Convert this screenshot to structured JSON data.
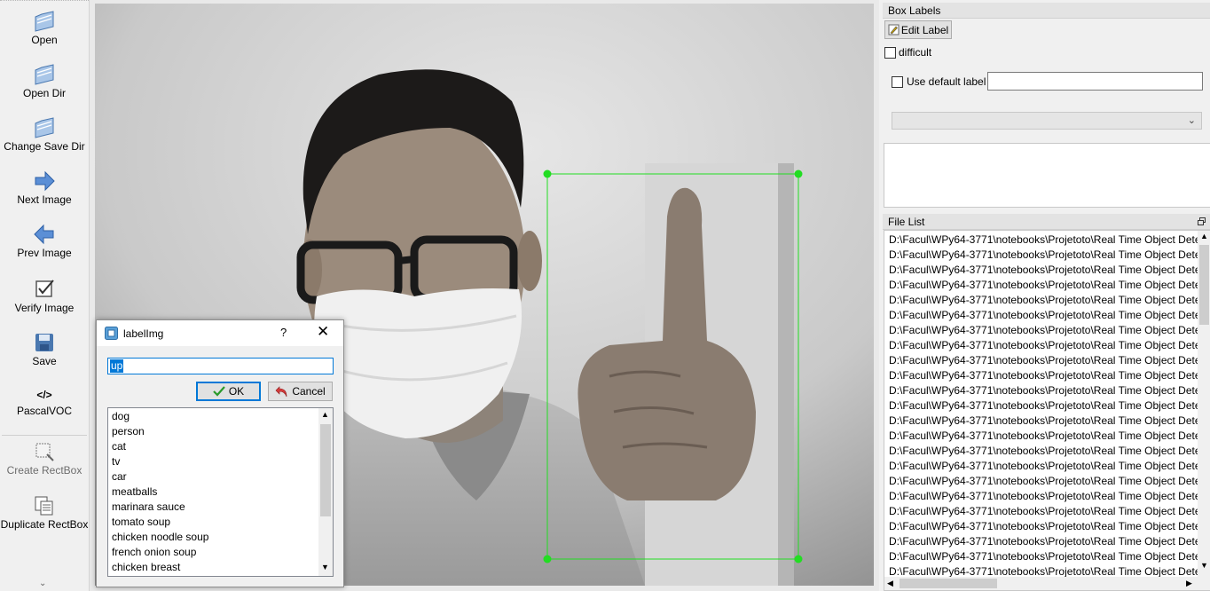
{
  "toolbar": {
    "open": "Open",
    "open_dir": "Open Dir",
    "change_save_dir": "Change Save Dir",
    "next_image": "Next Image",
    "prev_image": "Prev Image",
    "verify_image": "Verify Image",
    "save": "Save",
    "format": "PascalVOC",
    "format_icon": "</>",
    "create_rectbox": "Create RectBox",
    "duplicate_rectbox": "Duplicate RectBox",
    "more": "⌄"
  },
  "box_labels": {
    "title": "Box Labels",
    "edit_label": "Edit Label",
    "difficult": "difficult",
    "use_default_label": "Use default label",
    "default_label_value": "",
    "combo_value": ""
  },
  "file_list": {
    "title": "File List",
    "files": [
      "D:\\Facul\\WPy64-3771\\notebooks\\Projetoto\\Real Time Object Dete",
      "D:\\Facul\\WPy64-3771\\notebooks\\Projetoto\\Real Time Object Dete",
      "D:\\Facul\\WPy64-3771\\notebooks\\Projetoto\\Real Time Object Dete",
      "D:\\Facul\\WPy64-3771\\notebooks\\Projetoto\\Real Time Object Dete",
      "D:\\Facul\\WPy64-3771\\notebooks\\Projetoto\\Real Time Object Dete",
      "D:\\Facul\\WPy64-3771\\notebooks\\Projetoto\\Real Time Object Dete",
      "D:\\Facul\\WPy64-3771\\notebooks\\Projetoto\\Real Time Object Dete",
      "D:\\Facul\\WPy64-3771\\notebooks\\Projetoto\\Real Time Object Dete",
      "D:\\Facul\\WPy64-3771\\notebooks\\Projetoto\\Real Time Object Dete",
      "D:\\Facul\\WPy64-3771\\notebooks\\Projetoto\\Real Time Object Dete",
      "D:\\Facul\\WPy64-3771\\notebooks\\Projetoto\\Real Time Object Dete",
      "D:\\Facul\\WPy64-3771\\notebooks\\Projetoto\\Real Time Object Dete",
      "D:\\Facul\\WPy64-3771\\notebooks\\Projetoto\\Real Time Object Dete",
      "D:\\Facul\\WPy64-3771\\notebooks\\Projetoto\\Real Time Object Dete",
      "D:\\Facul\\WPy64-3771\\notebooks\\Projetoto\\Real Time Object Dete",
      "D:\\Facul\\WPy64-3771\\notebooks\\Projetoto\\Real Time Object Dete",
      "D:\\Facul\\WPy64-3771\\notebooks\\Projetoto\\Real Time Object Dete",
      "D:\\Facul\\WPy64-3771\\notebooks\\Projetoto\\Real Time Object Dete",
      "D:\\Facul\\WPy64-3771\\notebooks\\Projetoto\\Real Time Object Dete",
      "D:\\Facul\\WPy64-3771\\notebooks\\Projetoto\\Real Time Object Dete",
      "D:\\Facul\\WPy64-3771\\notebooks\\Projetoto\\Real Time Object Dete",
      "D:\\Facul\\WPy64-3771\\notebooks\\Projetoto\\Real Time Object Dete",
      "D:\\Facul\\WPy64-3771\\notebooks\\Projetoto\\Real Time Object Dete"
    ]
  },
  "dialog": {
    "title": "labelImg",
    "help": "?",
    "close": "✕",
    "input_value": "up",
    "ok": "OK",
    "cancel": "Cancel",
    "labels": [
      "dog",
      "person",
      "cat",
      "tv",
      "car",
      "meatballs",
      "marinara sauce",
      "tomato soup",
      "chicken noodle soup",
      "french onion soup",
      "chicken breast"
    ]
  },
  "colors": {
    "bbox": "#22dd22",
    "selection": "#0078d7"
  }
}
